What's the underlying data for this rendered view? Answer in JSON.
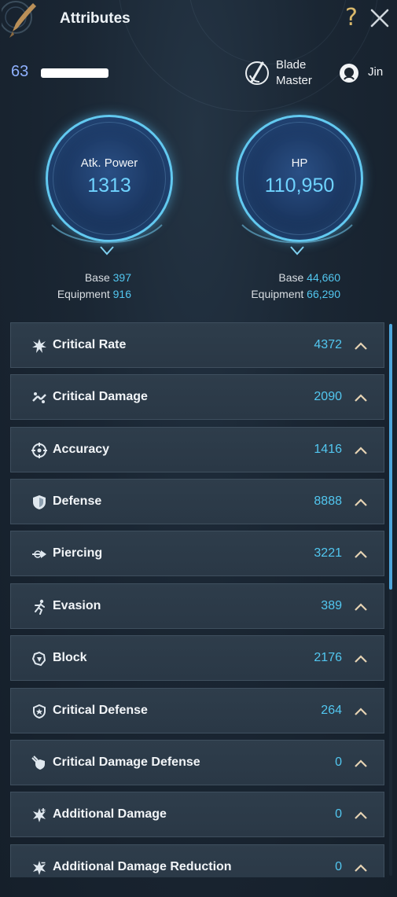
{
  "header": {
    "title": "Attributes",
    "help_label": "?",
    "logo_icon": "weapon-emblem-icon",
    "close_icon": "close-icon"
  },
  "player": {
    "level": "63",
    "name_hidden": true,
    "class_name": "Blade Master",
    "class_icon": "blade-master-icon",
    "race": "Jin",
    "race_icon": "jin-race-icon"
  },
  "stats": {
    "attack": {
      "label": "Atk. Power",
      "value": "1313",
      "base_label": "Base",
      "base_value": "397",
      "equipment_label": "Equipment",
      "equipment_value": "916"
    },
    "hp": {
      "label": "HP",
      "value": "110,950",
      "base_label": "Base",
      "base_value": "44,660",
      "equipment_label": "Equipment",
      "equipment_value": "66,290"
    }
  },
  "attributes": [
    {
      "label": "Critical Rate",
      "value": "4372",
      "icon": "critical-rate-icon"
    },
    {
      "label": "Critical Damage",
      "value": "2090",
      "icon": "critical-damage-icon"
    },
    {
      "label": "Accuracy",
      "value": "1416",
      "icon": "accuracy-icon"
    },
    {
      "label": "Defense",
      "value": "8888",
      "icon": "defense-icon"
    },
    {
      "label": "Piercing",
      "value": "3221",
      "icon": "piercing-icon"
    },
    {
      "label": "Evasion",
      "value": "389",
      "icon": "evasion-icon"
    },
    {
      "label": "Block",
      "value": "2176",
      "icon": "block-icon"
    },
    {
      "label": "Critical Defense",
      "value": "264",
      "icon": "critical-defense-icon"
    },
    {
      "label": "Critical Damage Defense",
      "value": "0",
      "icon": "critical-damage-defense-icon"
    },
    {
      "label": "Additional Damage",
      "value": "0",
      "icon": "additional-damage-icon"
    },
    {
      "label": "Additional Damage Reduction",
      "value": "0",
      "icon": "additional-damage-reduction-icon"
    }
  ],
  "colors": {
    "accent_value": "#52c7f0",
    "orb_ring": "#62c9f0",
    "level": "#8fb1ff",
    "help": "#d9b86b"
  }
}
